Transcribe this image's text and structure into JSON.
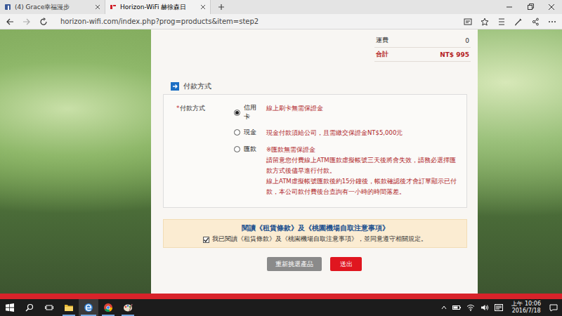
{
  "browser": {
    "tabs": [
      {
        "label": "(4) Grace幸福漫步",
        "selected": false
      },
      {
        "label": "Horizon-WiFi 赫徐森日",
        "selected": true
      }
    ],
    "address": "horizon-wifi.com/index.php?prog=products&item=step2"
  },
  "summary": [
    {
      "label": "運費",
      "value": "0",
      "kind": "plain"
    },
    {
      "label": "合計",
      "value": "NT$  995",
      "kind": "total"
    }
  ],
  "payment": {
    "heading": "付款方式",
    "required_mark": "*",
    "label": "付款方式",
    "options": [
      {
        "name": "信用卡",
        "selected": true,
        "notes": [
          "線上刷卡無需保證金"
        ]
      },
      {
        "name": "現金",
        "selected": false,
        "notes": [
          "現金付款須給公司，且需繳交保證金NT$5,000元"
        ]
      },
      {
        "name": "匯款",
        "selected": false,
        "notes": [
          "※匯款無需保證金",
          "請留意您付費線上ATM匯款虛擬帳號三天後將會失效，請務必選擇匯款方式後儘早進行付款。",
          "線上ATM虛擬帳號匯款後約15分鐘後，帳款確認後才會訂單顯示已付款，本公司款付費後台查詢有一小時的時間落差。"
        ]
      }
    ]
  },
  "terms": {
    "title": "閱讀《租賃條款》及《桃園機場自取注意事項》",
    "checked": true,
    "text": "我已閱讀《租賃條款》及《桃園機場自取注意事項》，並同意遵守相關規定。"
  },
  "buttons": [
    {
      "label": "重新挑選產品",
      "kind": "secondary"
    },
    {
      "label": "送出",
      "kind": "primary"
    }
  ],
  "taskbar": {
    "apps": [
      {
        "kind": "explorer",
        "selected": false
      },
      {
        "kind": "edge",
        "selected": true
      },
      {
        "kind": "chrome",
        "selected": false
      },
      {
        "kind": "paint",
        "selected": false
      }
    ],
    "time": "上午 10:06",
    "date": "2016/7/18"
  }
}
